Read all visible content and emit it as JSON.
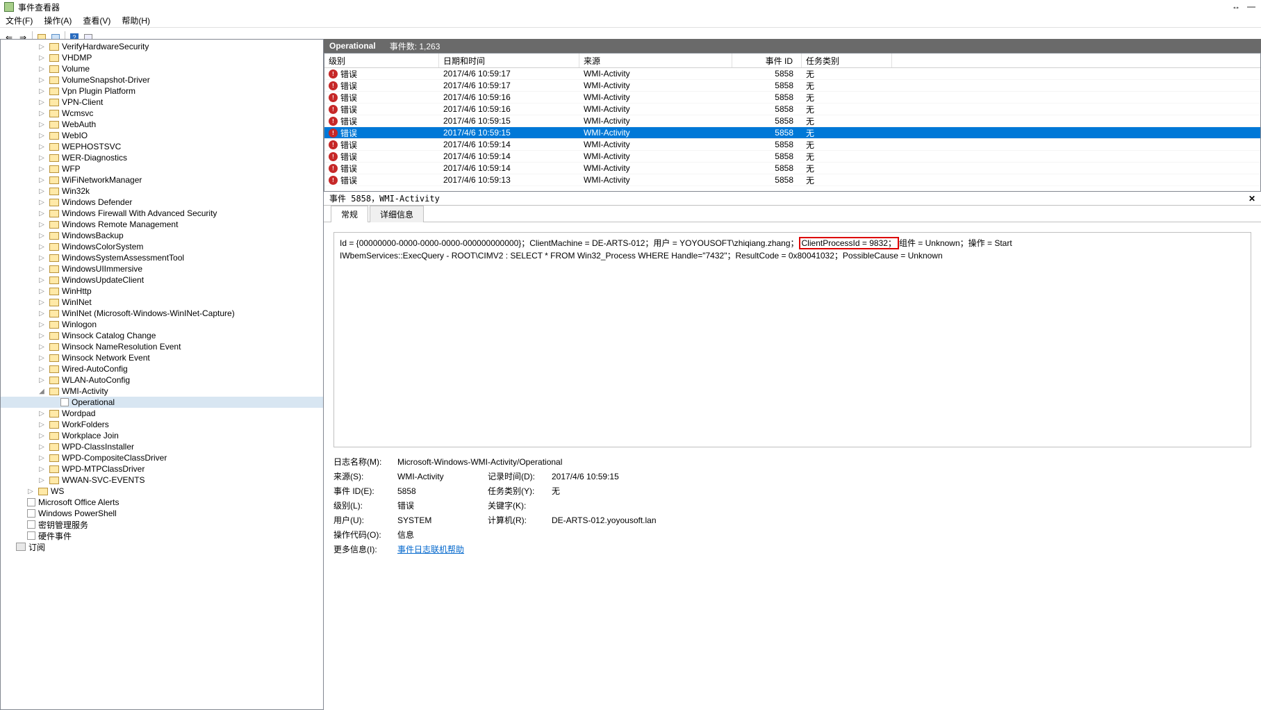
{
  "window": {
    "title": "事件查看器"
  },
  "wincontrols": {
    "resize": "↔",
    "min": "—"
  },
  "menu": {
    "file": "文件(F)",
    "action": "操作(A)",
    "view": "查看(V)",
    "help": "帮助(H)"
  },
  "listheader": {
    "name": "Operational",
    "count_label": "事件数: 1,263"
  },
  "columns": {
    "level": "级别",
    "date": "日期和时间",
    "source": "来源",
    "id": "事件 ID",
    "cat": "任务类别"
  },
  "rows": [
    {
      "level": "错误",
      "date": "2017/4/6 10:59:17",
      "source": "WMI-Activity",
      "id": "5858",
      "cat": "无",
      "sel": false
    },
    {
      "level": "错误",
      "date": "2017/4/6 10:59:17",
      "source": "WMI-Activity",
      "id": "5858",
      "cat": "无",
      "sel": false
    },
    {
      "level": "错误",
      "date": "2017/4/6 10:59:16",
      "source": "WMI-Activity",
      "id": "5858",
      "cat": "无",
      "sel": false
    },
    {
      "level": "错误",
      "date": "2017/4/6 10:59:16",
      "source": "WMI-Activity",
      "id": "5858",
      "cat": "无",
      "sel": false
    },
    {
      "level": "错误",
      "date": "2017/4/6 10:59:15",
      "source": "WMI-Activity",
      "id": "5858",
      "cat": "无",
      "sel": false
    },
    {
      "level": "错误",
      "date": "2017/4/6 10:59:15",
      "source": "WMI-Activity",
      "id": "5858",
      "cat": "无",
      "sel": true
    },
    {
      "level": "错误",
      "date": "2017/4/6 10:59:14",
      "source": "WMI-Activity",
      "id": "5858",
      "cat": "无",
      "sel": false
    },
    {
      "level": "错误",
      "date": "2017/4/6 10:59:14",
      "source": "WMI-Activity",
      "id": "5858",
      "cat": "无",
      "sel": false
    },
    {
      "level": "错误",
      "date": "2017/4/6 10:59:14",
      "source": "WMI-Activity",
      "id": "5858",
      "cat": "无",
      "sel": false
    },
    {
      "level": "错误",
      "date": "2017/4/6 10:59:13",
      "source": "WMI-Activity",
      "id": "5858",
      "cat": "无",
      "sel": false
    }
  ],
  "tree": [
    "VerifyHardwareSecurity",
    "VHDMP",
    "Volume",
    "VolumeSnapshot-Driver",
    "Vpn Plugin Platform",
    "VPN-Client",
    "Wcmsvc",
    "WebAuth",
    "WebIO",
    "WEPHOSTSVC",
    "WER-Diagnostics",
    "WFP",
    "WiFiNetworkManager",
    "Win32k",
    "Windows Defender",
    "Windows Firewall With Advanced Security",
    "Windows Remote Management",
    "WindowsBackup",
    "WindowsColorSystem",
    "WindowsSystemAssessmentTool",
    "WindowsUIImmersive",
    "WindowsUpdateClient",
    "WinHttp",
    "WinINet",
    "WinINet (Microsoft-Windows-WinINet-Capture)",
    "Winlogon",
    "Winsock Catalog Change",
    "Winsock NameResolution Event",
    "Winsock Network Event",
    "Wired-AutoConfig",
    "WLAN-AutoConfig"
  ],
  "tree_wmi": {
    "parent": "WMI-Activity",
    "child": "Operational"
  },
  "tree_after_wmi": [
    "Wordpad",
    "WorkFolders",
    "Workplace Join",
    "WPD-ClassInstaller",
    "WPD-CompositeClassDriver",
    "WPD-MTPClassDriver",
    "WWAN-SVC-EVENTS"
  ],
  "tree_bottom": {
    "ws": "WS",
    "msoffice": "Microsoft Office Alerts",
    "ps": "Windows PowerShell",
    "keymgmt": "密钥管理服务",
    "hw": "硬件事件",
    "sub": "订阅"
  },
  "detail": {
    "header": "事件 5858，WMI-Activity",
    "tabs": {
      "general": "常规",
      "details": "详细信息"
    },
    "desc_pre": "Id = {00000000-0000-0000-0000-000000000000}；ClientMachine = DE-ARTS-012；用户 = YOYOUSOFT\\zhiqiang.zhang；",
    "desc_hl": "ClientProcessId = 9832；",
    "desc_mid": "组件 = Unknown；操作 = Start",
    "desc_line2": "IWbemServices::ExecQuery - ROOT\\CIMV2 : SELECT * FROM Win32_Process WHERE Handle=\"7432\"；ResultCode = 0x80041032；PossibleCause = Unknown",
    "meta": {
      "logname_l": "日志名称(M):",
      "logname_v": "Microsoft-Windows-WMI-Activity/Operational",
      "source_l": "来源(S):",
      "source_v": "WMI-Activity",
      "time_l": "记录时间(D):",
      "time_v": "2017/4/6 10:59:15",
      "evid_l": "事件 ID(E):",
      "evid_v": "5858",
      "cat_l": "任务类别(Y):",
      "cat_v": "无",
      "level_l": "级别(L):",
      "level_v": "错误",
      "kw_l": "关键字(K):",
      "kw_v": "",
      "user_l": "用户(U):",
      "user_v": "SYSTEM",
      "comp_l": "计算机(R):",
      "comp_v": "DE-ARTS-012.yoyousoft.lan",
      "opcode_l": "操作代码(O):",
      "opcode_v": "信息",
      "more_l": "更多信息(I):",
      "more_v": "事件日志联机帮助"
    }
  },
  "close_x": "✕"
}
